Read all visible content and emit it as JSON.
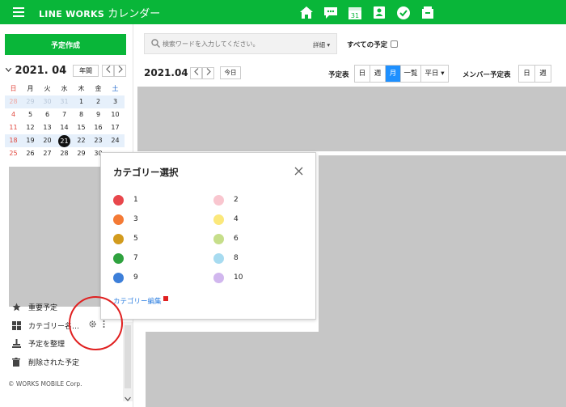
{
  "header": {
    "brand": "LINE WORKS",
    "app": "カレンダー",
    "apps": [
      {
        "name": "home-icon"
      },
      {
        "name": "message-icon"
      },
      {
        "name": "calendar-icon",
        "label": "31"
      },
      {
        "name": "contacts-icon"
      },
      {
        "name": "task-icon"
      },
      {
        "name": "drive-icon"
      }
    ]
  },
  "sidebar": {
    "create_label": "予定作成",
    "mini_title": "2021. 04",
    "year_label": "年間",
    "weekdays": [
      "日",
      "月",
      "火",
      "水",
      "木",
      "金",
      "土"
    ],
    "weeks": [
      [
        "28",
        "29",
        "30",
        "31",
        "1",
        "2",
        "3"
      ],
      [
        "4",
        "5",
        "6",
        "7",
        "8",
        "9",
        "10"
      ],
      [
        "11",
        "12",
        "13",
        "14",
        "15",
        "16",
        "17"
      ],
      [
        "18",
        "19",
        "20",
        "21",
        "22",
        "23",
        "24"
      ],
      [
        "25",
        "26",
        "27",
        "28",
        "29",
        "30",
        ""
      ]
    ],
    "today": "21",
    "menu": [
      {
        "label": "重要予定",
        "icon": "star-icon"
      },
      {
        "label": "カテゴリー名…",
        "icon": "grid-icon"
      },
      {
        "label": "予定を整理",
        "icon": "organize-icon"
      },
      {
        "label": "削除された予定",
        "icon": "trash-icon"
      }
    ],
    "copyright": "© WORKS MOBILE Corp."
  },
  "main": {
    "search_placeholder": "検索ワードを入力してください。",
    "detail_label": "詳細 ▾",
    "all_schedules": "すべての予定",
    "current_month": "2021.04",
    "today_label": "今日",
    "schedule_label": "予定表",
    "views": [
      "日",
      "週",
      "月",
      "一覧",
      "平日 ▾"
    ],
    "active_view": "月",
    "member_label": "メンバー予定表",
    "member_views": [
      "日",
      "週"
    ]
  },
  "dialog": {
    "title": "カテゴリー選択",
    "edit_label": "カテゴリー編集",
    "categories": [
      {
        "label": "1",
        "color": "#e8474c"
      },
      {
        "label": "2",
        "color": "#f9c6cf"
      },
      {
        "label": "3",
        "color": "#f47a35"
      },
      {
        "label": "4",
        "color": "#fbe87b"
      },
      {
        "label": "5",
        "color": "#d29b1e"
      },
      {
        "label": "6",
        "color": "#c6de8a"
      },
      {
        "label": "7",
        "color": "#2fa23f"
      },
      {
        "label": "8",
        "color": "#a7dbf0"
      },
      {
        "label": "9",
        "color": "#3d7fd9"
      },
      {
        "label": "10",
        "color": "#d1b7ee"
      }
    ]
  },
  "colors": {
    "brand": "#09b639",
    "accent": "#1e90ff",
    "annotation": "#e02020"
  }
}
